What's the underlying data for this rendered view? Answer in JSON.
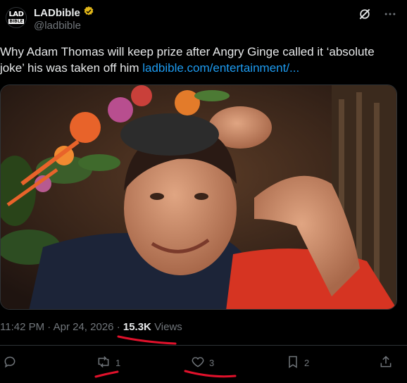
{
  "author": {
    "avatar_line1": "LAD",
    "avatar_line2": "BIBLE",
    "name": "LADbible",
    "handle": "@ladbible",
    "verified": true
  },
  "header_icons": [
    "grok-icon",
    "more-icon"
  ],
  "tweet": {
    "text": "Why Adam Thomas will keep prize after Angry Ginge called it ‘absolute joke’ his was taken off him ",
    "link": "ladbible.com/entertainment/..."
  },
  "meta": {
    "time": "11:42 PM",
    "date": "Apr 24, 2026",
    "views_count": "15.3K",
    "views_label": "Views",
    "separator": "·"
  },
  "actions": {
    "reply_count": "",
    "retweet_count": "1",
    "like_count": "3",
    "bookmark_count": "2"
  },
  "colors": {
    "accent": "#1d9bf0",
    "muted": "#71767b",
    "text": "#e7e9ea",
    "annotation": "#e0112b"
  }
}
